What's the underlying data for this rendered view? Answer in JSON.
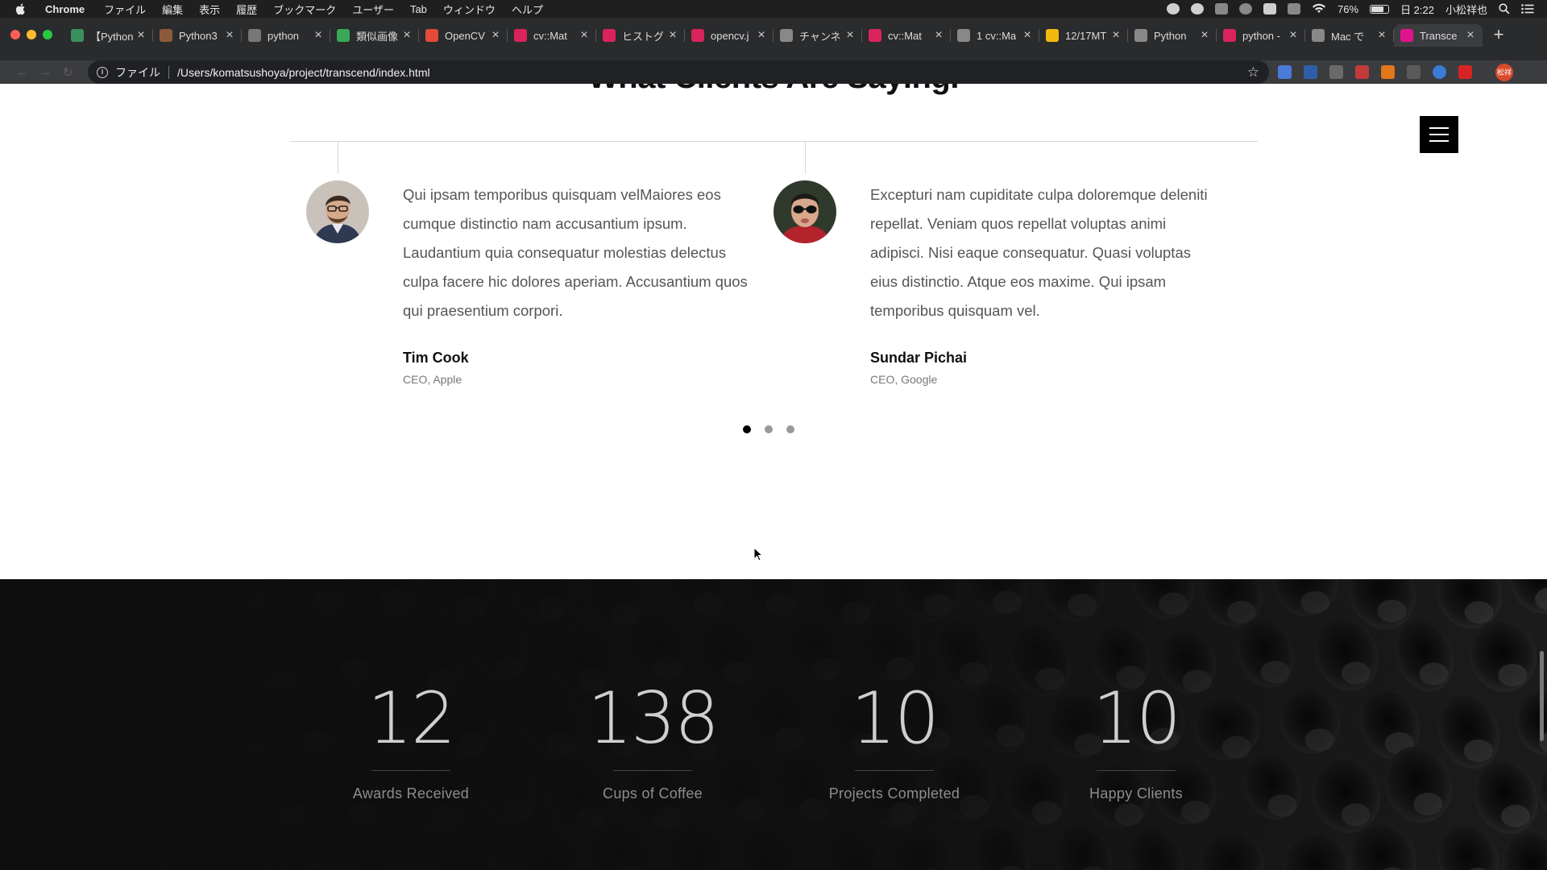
{
  "menubar": {
    "app": "Chrome",
    "items": [
      "ファイル",
      "編集",
      "表示",
      "履歴",
      "ブックマーク",
      "ユーザー",
      "Tab",
      "ウィンドウ",
      "ヘルプ"
    ],
    "battery": "76%",
    "clock": "日 2:22",
    "user": "小松祥也"
  },
  "tabs": [
    {
      "label": "【Python",
      "color": "#3a8f5e"
    },
    {
      "label": "Python3",
      "color": "#8c5a3a"
    },
    {
      "label": "python",
      "color": "#777777"
    },
    {
      "label": "類似画像",
      "color": "#3aa856"
    },
    {
      "label": "OpenCV",
      "color": "#e24a3a"
    },
    {
      "label": "cv::Mat",
      "color": "#d9235c"
    },
    {
      "label": "ヒストグ",
      "color": "#d9235c"
    },
    {
      "label": "opencv.j",
      "color": "#d9235c"
    },
    {
      "label": "チャンネ",
      "color": "#888888"
    },
    {
      "label": "cv::Mat",
      "color": "#d9235c"
    },
    {
      "label": "1 cv::Ma",
      "color": "#888888"
    },
    {
      "label": "12/17MT",
      "color": "#f2b90c"
    },
    {
      "label": "Python",
      "color": "#888888"
    },
    {
      "label": "python -",
      "color": "#d9235c"
    },
    {
      "label": "Mac で",
      "color": "#888888"
    },
    {
      "label": "Transce",
      "color": "#e0148a",
      "active": true
    }
  ],
  "omnibox": {
    "scheme": "ファイル",
    "url": "/Users/komatsushoya/project/transcend/index.html"
  },
  "section": {
    "title": "What Clients Are Saying."
  },
  "testimonials": [
    {
      "quote": "Qui ipsam temporibus quisquam velMaiores eos cumque distinctio nam accusantium ipsum. Laudantium quia consequatur molestias delectus culpa facere hic dolores aperiam. Accusantium quos qui praesentium corpori.",
      "name": "Tim Cook",
      "role": "CEO, Apple"
    },
    {
      "quote": "Excepturi nam cupiditate culpa doloremque deleniti repellat. Veniam quos repellat voluptas animi adipisci. Nisi eaque consequatur. Quasi voluptas eius distinctio. Atque eos maxime. Qui ipsam temporibus quisquam vel.",
      "name": "Sundar Pichai",
      "role": "CEO, Google"
    }
  ],
  "carousel": {
    "count": 3,
    "active": 1
  },
  "stats": [
    {
      "value": "12",
      "label": "Awards Received"
    },
    {
      "value": "138",
      "label": "Cups of Coffee"
    },
    {
      "value": "10",
      "label": "Projects Completed"
    },
    {
      "value": "10",
      "label": "Happy Clients"
    }
  ]
}
